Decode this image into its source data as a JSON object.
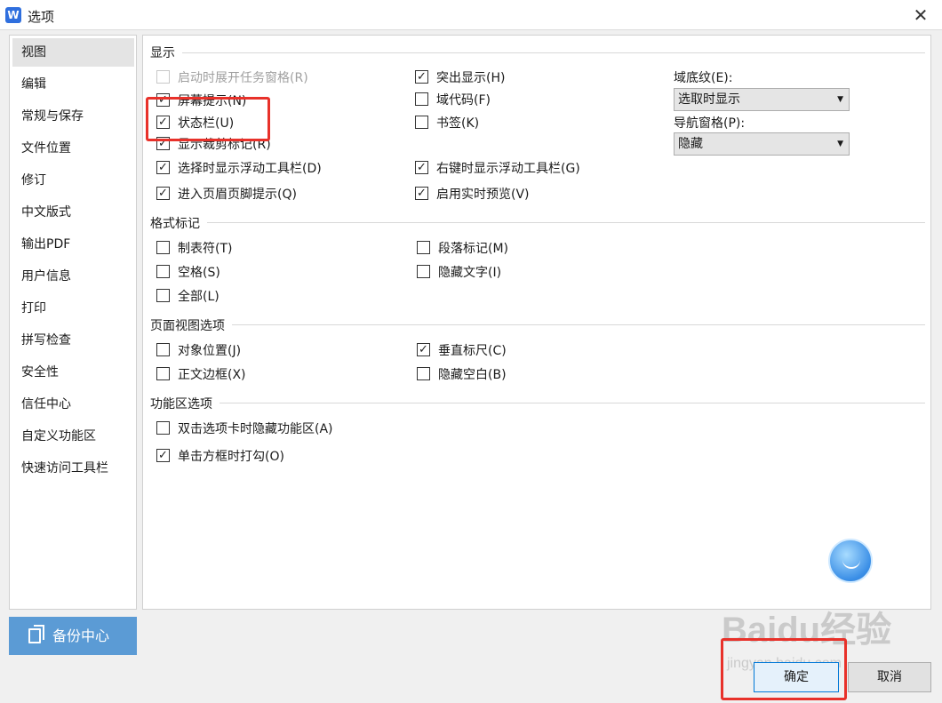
{
  "window": {
    "title": "选项",
    "app_icon": "W",
    "close": "✕"
  },
  "sidebar": {
    "items": [
      {
        "label": "视图",
        "active": true
      },
      {
        "label": "编辑"
      },
      {
        "label": "常规与保存"
      },
      {
        "label": "文件位置"
      },
      {
        "label": "修订"
      },
      {
        "label": "中文版式"
      },
      {
        "label": "输出PDF"
      },
      {
        "label": "用户信息"
      },
      {
        "label": "打印"
      },
      {
        "label": "拼写检查"
      },
      {
        "label": "安全性"
      },
      {
        "label": "信任中心"
      },
      {
        "label": "自定义功能区"
      },
      {
        "label": "快速访问工具栏"
      }
    ],
    "backup_button": "备份中心"
  },
  "display": {
    "title": "显示",
    "options": [
      {
        "label": "启动时展开任务窗格(R)",
        "checked": false,
        "disabled": true
      },
      {
        "label": "屏幕提示(N)",
        "checked": true
      },
      {
        "label": "状态栏(U)",
        "checked": true
      },
      {
        "label": "显示裁剪标记(R)",
        "checked": true
      },
      {
        "label": "选择时显示浮动工具栏(D)",
        "checked": true
      },
      {
        "label": "进入页眉页脚提示(Q)",
        "checked": true
      },
      {
        "label": "突出显示(H)",
        "checked": true
      },
      {
        "label": "域代码(F)",
        "checked": false
      },
      {
        "label": "书签(K)",
        "checked": false
      },
      {
        "label": "右键时显示浮动工具栏(G)",
        "checked": true
      },
      {
        "label": "启用实时预览(V)",
        "checked": true
      }
    ],
    "field_shading": {
      "label": "域底纹(E):",
      "value": "选取时显示"
    },
    "nav_pane": {
      "label": "导航窗格(P):",
      "value": "隐藏"
    }
  },
  "format_marks": {
    "title": "格式标记",
    "options": [
      {
        "label": "制表符(T)",
        "checked": false
      },
      {
        "label": "空格(S)",
        "checked": false
      },
      {
        "label": "全部(L)",
        "checked": false
      },
      {
        "label": "段落标记(M)",
        "checked": false
      },
      {
        "label": "隐藏文字(I)",
        "checked": false
      }
    ]
  },
  "page_view": {
    "title": "页面视图选项",
    "options": [
      {
        "label": "对象位置(J)",
        "checked": false
      },
      {
        "label": "正文边框(X)",
        "checked": false
      },
      {
        "label": "垂直标尺(C)",
        "checked": true
      },
      {
        "label": "隐藏空白(B)",
        "checked": false
      }
    ]
  },
  "ribbon": {
    "title": "功能区选项",
    "options": [
      {
        "label": "双击选项卡时隐藏功能区(A)",
        "checked": false
      },
      {
        "label": "单击方框时打勾(O)",
        "checked": true
      }
    ]
  },
  "buttons": {
    "ok": "确定",
    "cancel": "取消"
  },
  "watermark": {
    "main": "Baidu经验",
    "sub": "jingyan.baidu.com"
  },
  "colors": {
    "accent": "#5b9bd5",
    "highlight": "#e8312a",
    "ok_border": "#0078d7"
  },
  "icons": {
    "check": "✓",
    "dropdown": "▼"
  }
}
